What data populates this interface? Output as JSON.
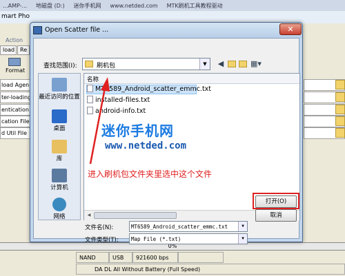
{
  "taskbar": {
    "items": [
      "...AMP-...",
      "地磁盘 (D:)",
      "迷你手机网",
      "www.netded.com",
      "MTK刷机工具教程驱动"
    ]
  },
  "bg_app": {
    "title": "mart Pho",
    "tabs": [
      "load",
      "Re"
    ],
    "action": "Action",
    "format_label": "Format",
    "rows": [
      "load Agen",
      "ter-loading F",
      "entication F",
      "cation File",
      "d Util File"
    ]
  },
  "dialog": {
    "title": "Open Scatter file ...",
    "close_glyph": "✕",
    "look_in_label": "查找范围(I):",
    "look_in_value": "刷机包",
    "places": [
      "最近访问的位置",
      "桌面",
      "库",
      "计算机",
      "网络"
    ],
    "column_name": "名称",
    "files": [
      "MT6589_Android_scatter_emmc.txt",
      "installed-files.txt",
      "android-info.txt"
    ],
    "filename_label": "文件名(N):",
    "filename_value": "MT6589_Android_scatter_emmc.txt",
    "filetype_label": "文件类型(T):",
    "filetype_value": "Map File (*.txt)",
    "open_button": "打开(O)",
    "cancel_button": "取消"
  },
  "watermark": {
    "title": "迷你手机网",
    "url": "www.netded.com"
  },
  "annotation": "进入刷机包文件夹里选中这个文件",
  "status": {
    "progress": "0%",
    "progress_value": 0,
    "cells": [
      "NAND",
      "USB",
      "921600 bps"
    ],
    "mode": "DA DL All Without Battery (Full Speed)"
  },
  "colors": {
    "annotation": "#e02020",
    "watermark": "#1a7ae0",
    "selection": "#cce4fa"
  }
}
